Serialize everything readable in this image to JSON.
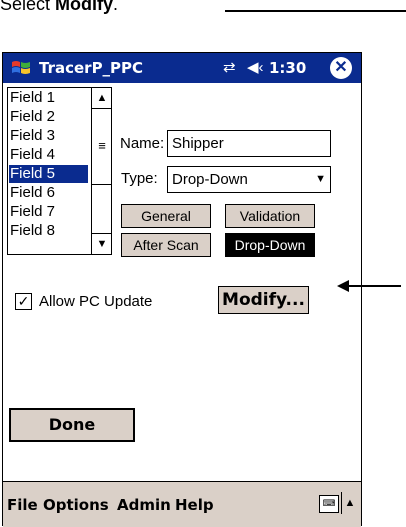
{
  "caption": {
    "prefix": "Select ",
    "bold": "Modify",
    "suffix": "."
  },
  "titlebar": {
    "title": "TracerP_PPC",
    "time": "1:30",
    "close_label": "✕"
  },
  "fields": [
    {
      "label": "Field 1",
      "selected": false
    },
    {
      "label": "Field 2",
      "selected": false
    },
    {
      "label": "Field 3",
      "selected": false
    },
    {
      "label": "Field 4",
      "selected": false
    },
    {
      "label": "Field 5",
      "selected": true
    },
    {
      "label": "Field 6",
      "selected": false
    },
    {
      "label": "Field 7",
      "selected": false
    },
    {
      "label": "Field 8",
      "selected": false
    }
  ],
  "form": {
    "name_label": "Name:",
    "name_value": "Shipper",
    "type_label": "Type:",
    "type_value": "Drop-Down"
  },
  "buttons": {
    "general": "General",
    "validation": "Validation",
    "after_scan": "After Scan",
    "drop_down": "Drop-Down",
    "modify": "Modify...",
    "done": "Done"
  },
  "allow_pc_update": {
    "label": "Allow PC Update",
    "checked": true
  },
  "menubar": {
    "file": "File",
    "options": "Options",
    "admin": "Admin",
    "help": "Help"
  },
  "icons": [
    "windows-flag-icon",
    "connectivity-icon",
    "volume-icon",
    "close-icon",
    "scroll-up-icon",
    "scroll-down-icon",
    "dropdown-chevron-icon",
    "checkmark-icon",
    "keyboard-icon",
    "arrow-up-icon",
    "pointer-arrow-icon"
  ],
  "colors": {
    "titlebar": "#0a2b8f",
    "button_face": "#dad0c8",
    "selection": "#0a2b8f"
  }
}
